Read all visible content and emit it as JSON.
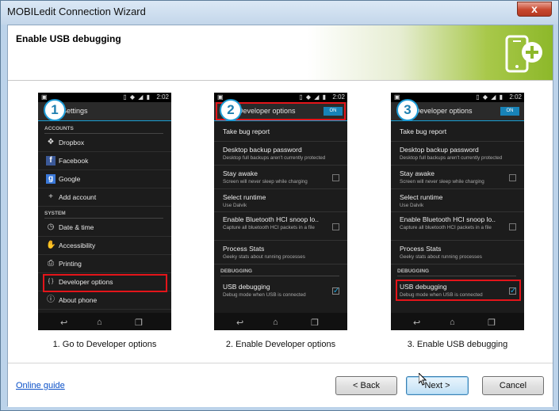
{
  "window": {
    "title": "MOBILedit Connection Wizard",
    "close_glyph": "x"
  },
  "header": {
    "title": "Enable USB debugging",
    "icon": "phone-add-icon",
    "accent": "#8db82a"
  },
  "status_time": "2:02",
  "steps": [
    {
      "number": "1",
      "caption": "1. Go to Developer options",
      "actionbar": "Settings",
      "accounts_header": "ACCOUNTS",
      "system_header": "SYSTEM",
      "accounts": [
        {
          "icon": "dropbox-icon",
          "glyph": "❖",
          "label": "Dropbox"
        },
        {
          "icon": "facebook-icon",
          "glyph": "f",
          "label": "Facebook"
        },
        {
          "icon": "google-icon",
          "glyph": "g",
          "label": "Google"
        },
        {
          "icon": "add-icon",
          "glyph": "+",
          "label": "Add account"
        }
      ],
      "system": [
        {
          "icon": "clock-icon",
          "glyph": "◷",
          "label": "Date & time"
        },
        {
          "icon": "hand-icon",
          "glyph": "✋",
          "label": "Accessibility"
        },
        {
          "icon": "printer-icon",
          "glyph": "⎙",
          "label": "Printing"
        },
        {
          "icon": "braces-icon",
          "glyph": "{ }",
          "label": "Developer options"
        },
        {
          "icon": "info-icon",
          "glyph": "ⓘ",
          "label": "About phone"
        }
      ]
    },
    {
      "number": "2",
      "caption": "2. Enable Developer options",
      "actionbar": "Developer options",
      "toggle": "ON"
    },
    {
      "number": "3",
      "caption": "3. Enable USB debugging",
      "actionbar": "Developer options",
      "toggle": "ON"
    }
  ],
  "dev_options": {
    "bug_report": "Take bug report",
    "backup_title": "Desktop backup password",
    "backup_sub": "Desktop full backups aren't currently protected",
    "awake_title": "Stay awake",
    "awake_sub": "Screen will never sleep while charging",
    "runtime_title": "Select runtime",
    "runtime_sub": "Use Dalvik",
    "hci_title": "Enable Bluetooth HCI snoop lo..",
    "hci_sub": "Capture all bluetooth HCI packets in a file",
    "process_title": "Process Stats",
    "process_sub": "Geeky stats about running processes",
    "debugging_header": "DEBUGGING",
    "usb_title": "USB debugging",
    "usb_sub": "Debug mode when USB is connected"
  },
  "footer": {
    "guide_link": "Online guide",
    "back": "< Back",
    "next": "Next >",
    "cancel": "Cancel"
  },
  "colors": {
    "highlight": "#e3151a",
    "badge": "#1e9cd7",
    "toggle": "#1883b8"
  }
}
